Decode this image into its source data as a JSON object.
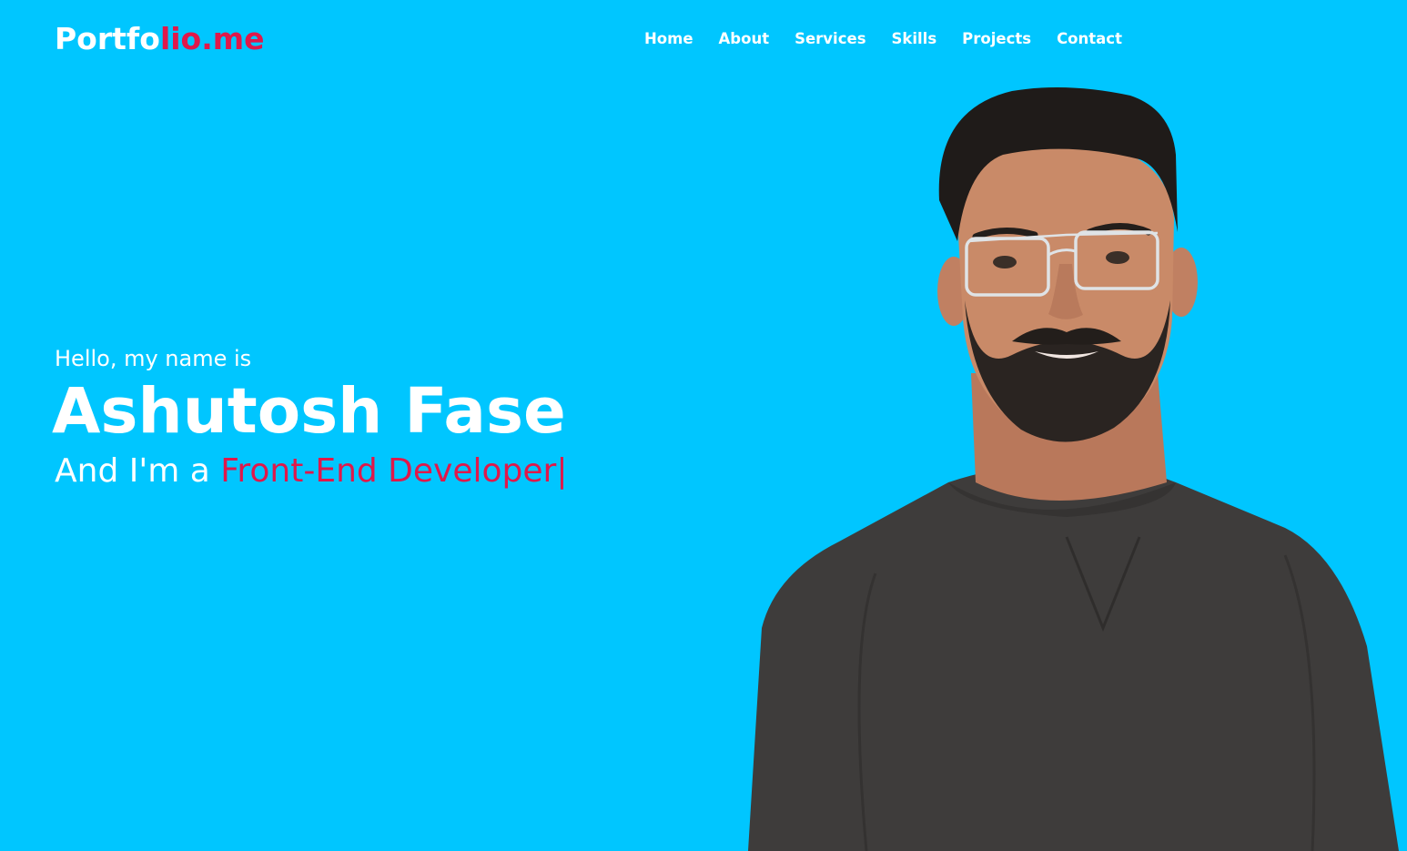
{
  "logo": {
    "part1": "Portfo",
    "part2": "lio.me"
  },
  "nav": {
    "items": [
      "Home",
      "About",
      "Services",
      "Skills",
      "Projects",
      "Contact"
    ]
  },
  "hero": {
    "greeting": "Hello, my name is",
    "name": "Ashutosh Fase",
    "role_prefix": "And I'm a ",
    "role_typed": "Front-End Developer",
    "cursor": "|"
  },
  "colors": {
    "background": "#00c6ff",
    "accent": "#e0184a",
    "text": "#ffffff",
    "shirt": "#3e3c3b",
    "skin": "#c98a68",
    "hair": "#1f1b19"
  },
  "icons": {
    "photo": "portrait-photo"
  }
}
